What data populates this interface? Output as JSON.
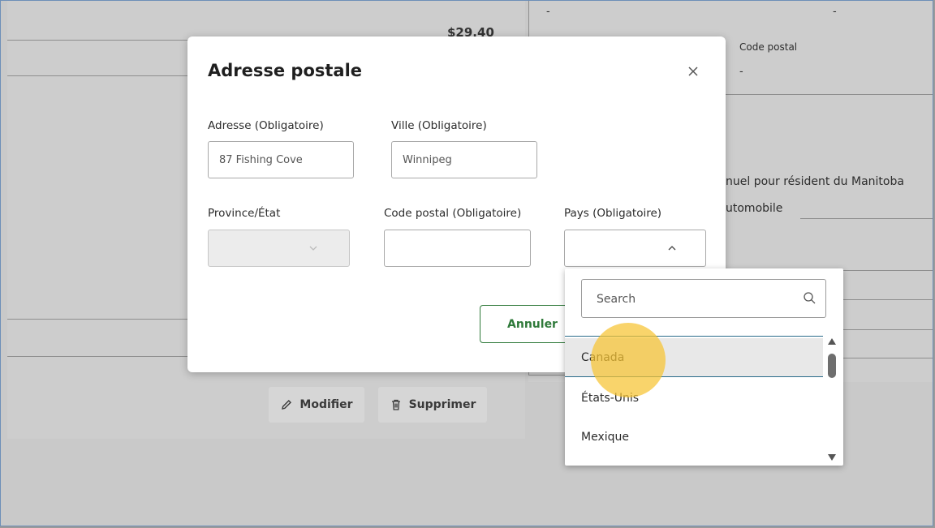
{
  "background": {
    "price": "$29.40",
    "dash_1": "-",
    "dash_2": "-",
    "postal_code_label": "Code postal",
    "postal_code_value": "-",
    "manitoba_text": "nuel pour résident du Manitoba",
    "auto_text": "utomobile",
    "edit_button": "Modifier",
    "delete_button": "Supprimer"
  },
  "modal": {
    "title": "Adresse postale",
    "address": {
      "label": "Adresse (Obligatoire)",
      "value": "87 Fishing Cove"
    },
    "city": {
      "label": "Ville (Obligatoire)",
      "value": "Winnipeg"
    },
    "province": {
      "label": "Province/État",
      "value": ""
    },
    "postal": {
      "label": "Code postal (Obligatoire)",
      "value": ""
    },
    "country": {
      "label": "Pays (Obligatoire)",
      "value": ""
    },
    "cancel_button": "Annuler"
  },
  "dropdown": {
    "search_placeholder": "Search",
    "options": [
      "Canada",
      "États-Unis",
      "Mexique"
    ],
    "highlighted": "Canada"
  },
  "colors": {
    "accent_green": "#2f7a3a",
    "focus_line": "#2a6c8a",
    "cursor_highlight": "#f6c432"
  }
}
